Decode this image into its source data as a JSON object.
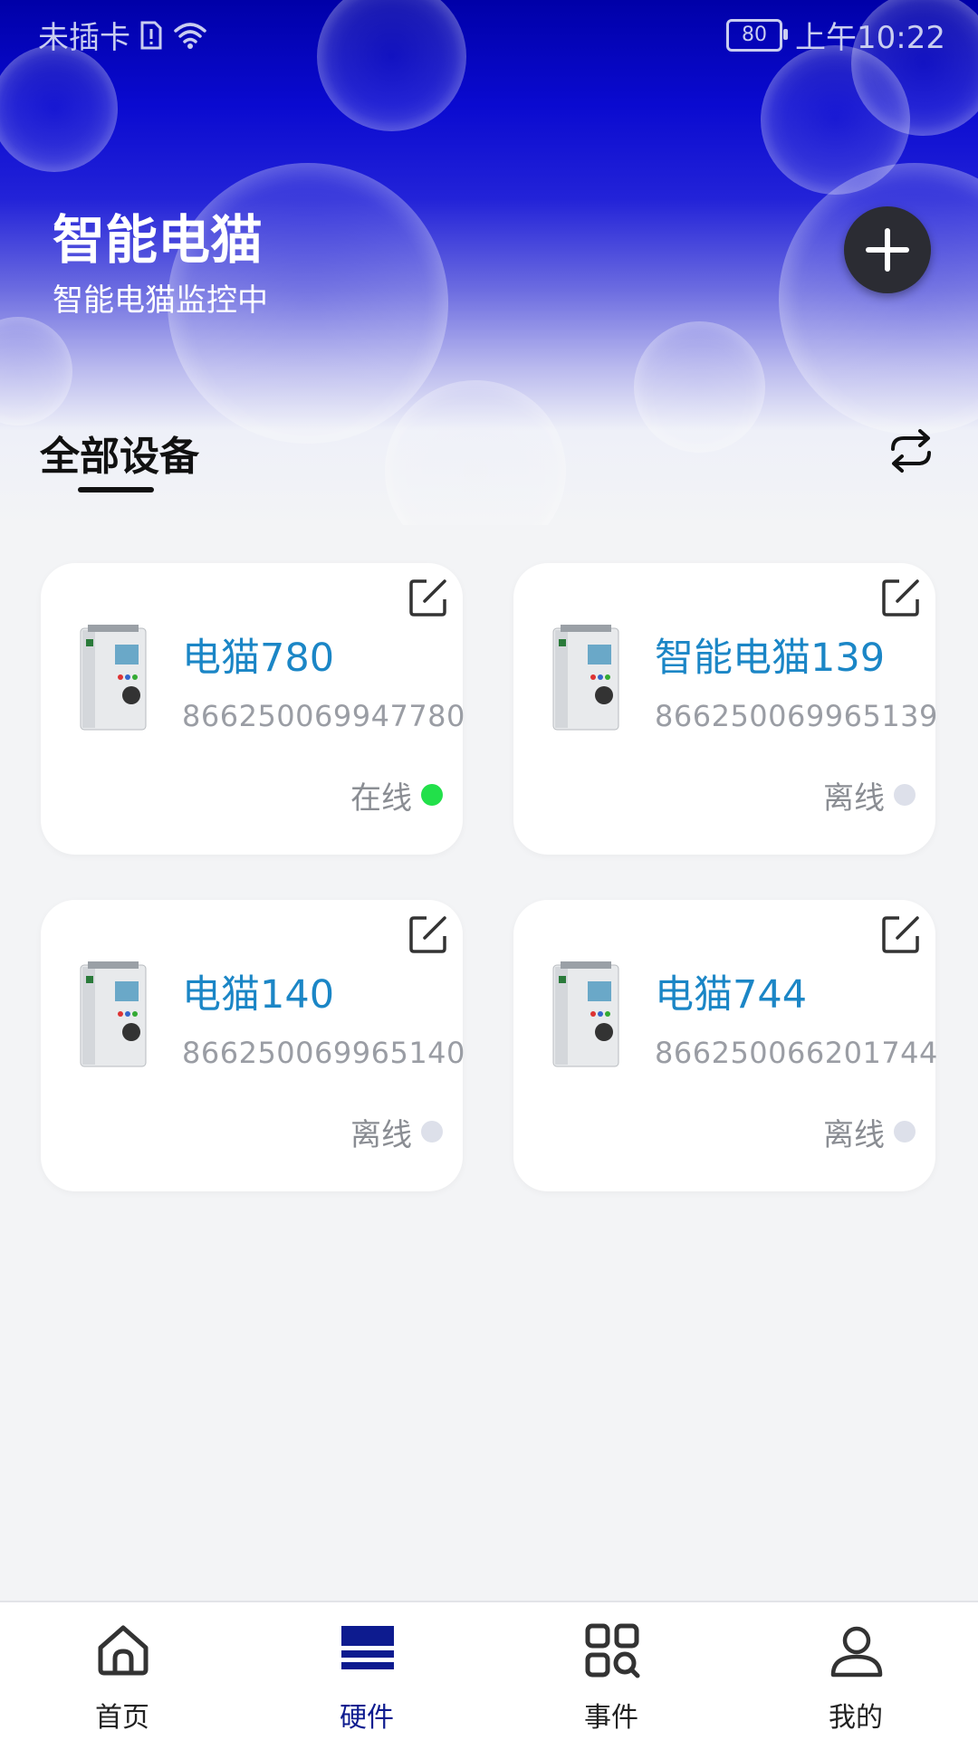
{
  "status_bar": {
    "carrier": "未插卡",
    "battery": "80",
    "time": "上午10:22"
  },
  "header": {
    "title": "智能电猫",
    "subtitle": "智能电猫监控中"
  },
  "tabs": {
    "all_devices": "全部设备"
  },
  "devices": [
    {
      "name": "电猫780",
      "imei": "866250069947780",
      "status": "在线",
      "online": true
    },
    {
      "name": "智能电猫139",
      "imei": "866250069965139",
      "status": "离线",
      "online": false
    },
    {
      "name": "电猫140",
      "imei": "866250069965140",
      "status": "离线",
      "online": false
    },
    {
      "name": "电猫744",
      "imei": "866250066201744",
      "status": "离线",
      "online": false
    }
  ],
  "colors": {
    "online": "#22e04a",
    "offline": "#dde0ea",
    "accent": "#1b86c6",
    "nav_active": "#0d1b8f"
  },
  "nav": [
    {
      "label": "首页",
      "icon": "home-icon"
    },
    {
      "label": "硬件",
      "icon": "hardware-icon"
    },
    {
      "label": "事件",
      "icon": "events-icon"
    },
    {
      "label": "我的",
      "icon": "profile-icon"
    }
  ],
  "nav_active_index": 1
}
